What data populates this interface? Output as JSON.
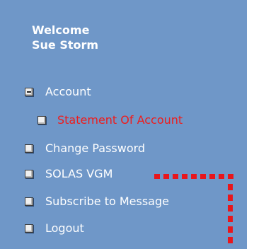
{
  "welcome": {
    "line1": "Welcome",
    "line2": "Sue Storm"
  },
  "menu": {
    "account": "Account",
    "statement": "Statement Of Account",
    "change_password": "Change Password",
    "solas_vgm": "SOLAS VGM",
    "subscribe": "Subscribe to Message",
    "logout": "Logout"
  },
  "colors": {
    "panel_background": "#6f97c8",
    "menu_text": "#ffffff",
    "active_submenu_text": "#ee1c1c",
    "annotation": "#e8161c"
  }
}
